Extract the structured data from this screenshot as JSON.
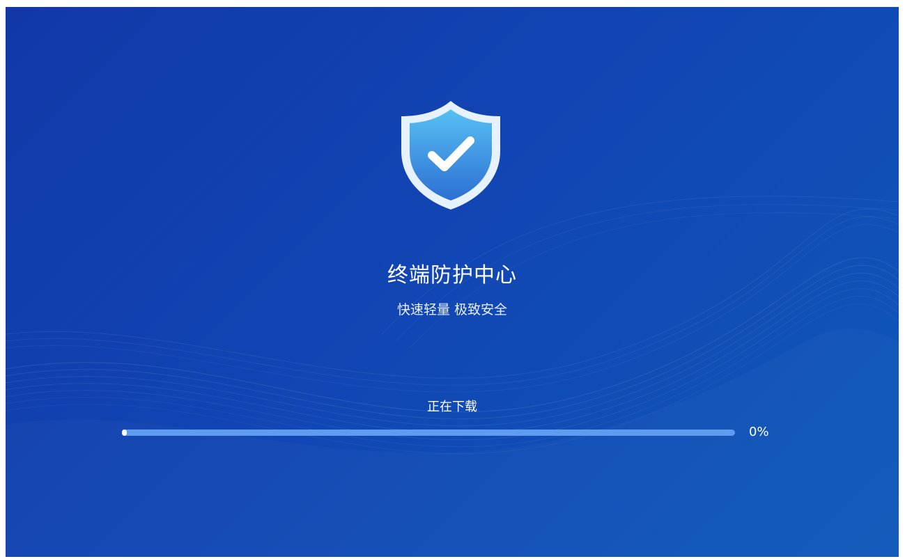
{
  "app": {
    "title": "终端防护中心",
    "subtitle": "快速轻量 极致安全"
  },
  "download": {
    "status": "正在下载",
    "percent_label": "0%",
    "progress_fraction": 0
  },
  "icons": {
    "logo": "shield-check-icon"
  },
  "colors": {
    "background_start": "#1238a8",
    "background_end": "#0f59ba",
    "progress_track": "#5f9cf0",
    "progress_fill": "#ffffff",
    "shield_outer": "#e6f2ff",
    "shield_inner_top": "#58c0f2",
    "shield_inner_bottom": "#2c6fd4"
  }
}
